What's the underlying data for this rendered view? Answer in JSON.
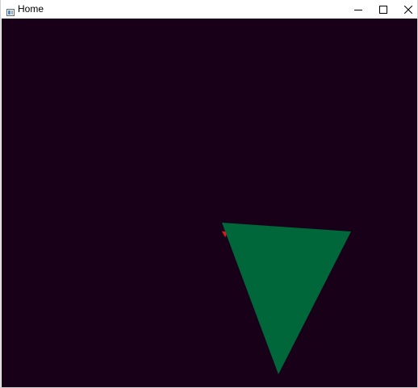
{
  "window": {
    "title": "Home",
    "icon": "app-window-icon",
    "controls": {
      "minimize_icon": "minimize-icon",
      "maximize_icon": "maximize-icon",
      "close_icon": "close-icon"
    }
  },
  "scene": {
    "background_color": "#180118",
    "shapes": [
      {
        "name": "green-triangle",
        "color": "#00673a"
      },
      {
        "name": "red-triangle-marker",
        "color": "#e0181c"
      }
    ]
  }
}
